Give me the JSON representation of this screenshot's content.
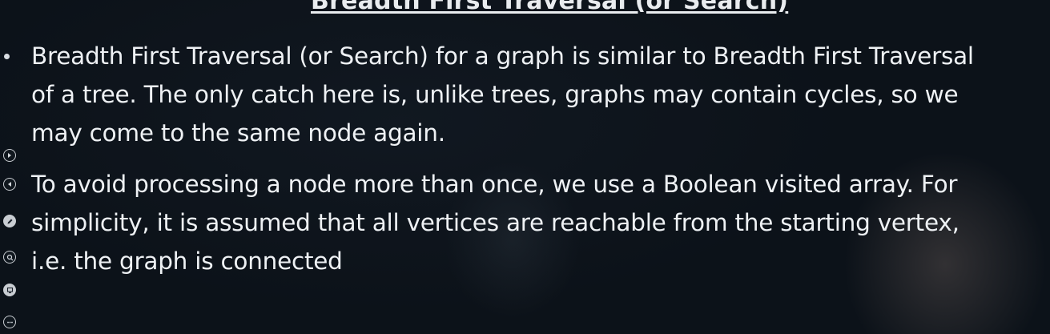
{
  "slide": {
    "title": "Breadth First Traversal (or Search)",
    "bullets": [
      {
        "lines": [
          "Breadth First Traversal (or Search) for a graph is similar to Breadth First Traversal",
          "of a tree. The only catch here is, unlike trees, graphs may contain cycles, so we",
          "may come to the same node again."
        ]
      },
      {
        "lines": [
          "To avoid processing a node more than once, we use a Boolean visited array. For",
          "simplicity, it is assumed that all vertices are reachable from the starting vertex,",
          "i.e. the graph is connected"
        ]
      }
    ]
  },
  "presenter_toolbar": {
    "icons": [
      "next-slide-icon",
      "previous-slide-icon",
      "pen-icon",
      "zoom-icon",
      "slides-icon",
      "more-options-icon"
    ]
  },
  "colors": {
    "background": "#0c1219",
    "text": "#eef1f4"
  }
}
